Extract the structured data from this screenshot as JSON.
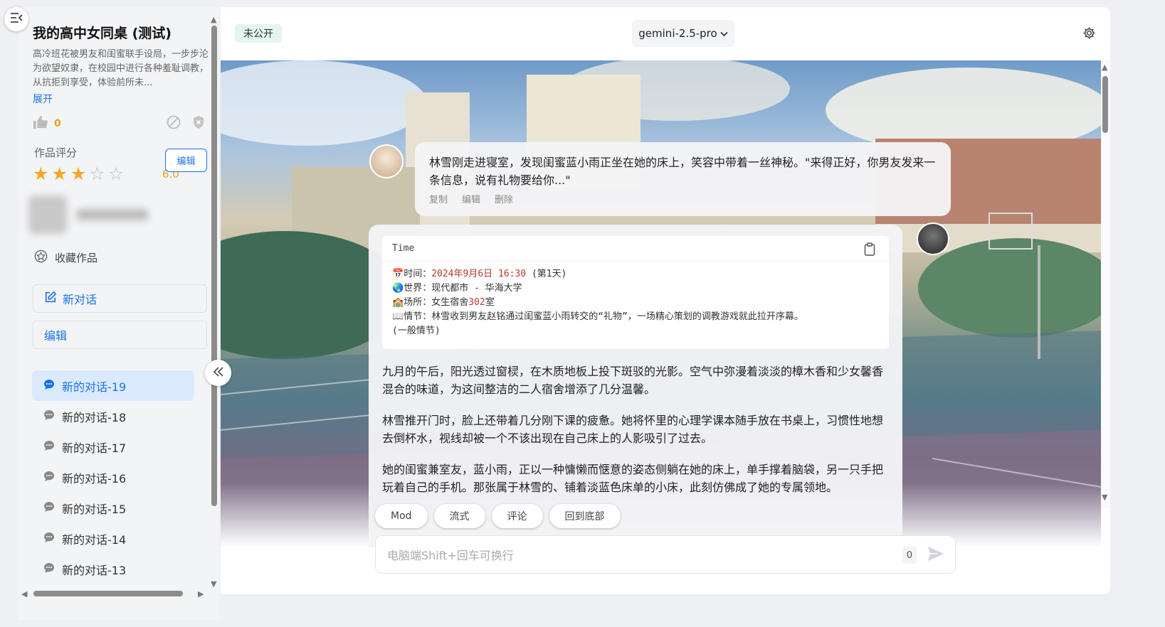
{
  "sidebar": {
    "title": "我的高中女同桌 (测试)",
    "description": "高冷班花被男友和闺蜜联手设局，一步步沦为欲望奴隶，在校园中进行各种羞耻调教，从抗拒到享受，体验前所未...",
    "expand": "展开",
    "likes": "0",
    "rating_label": "作品评分",
    "rating": "6.0",
    "stars_filled": 3,
    "stars_total": 5,
    "edit_small": "编辑",
    "favorite": "收藏作品",
    "new_chat": "新对话",
    "edit_large": "编辑",
    "conversations": [
      "新的对话-19",
      "新的对话-18",
      "新的对话-17",
      "新的对话-16",
      "新的对话-15",
      "新的对话-14",
      "新的对话-13"
    ]
  },
  "header": {
    "status_badge": "未公开",
    "model": "gemini-2.5-pro"
  },
  "chat": {
    "first_message": "林雪刚走进寝室，发现闺蜜蓝小雨正坐在她的床上，笑容中带着一丝神秘。\"来得正好，你男友发来一条信息，说有礼物要给你...\"",
    "actions": {
      "copy": "复制",
      "edit": "编辑",
      "delete": "删除"
    },
    "time_block": {
      "title": "Time",
      "time_label": "时间：",
      "time_date": "2024年9月6日",
      "time_clock": "16:30",
      "time_day": "(第1天)",
      "world": "世界：现代都市 - 华海大学",
      "place_label": "场所：女生宿舍",
      "place_room": "302",
      "place_suffix": "室",
      "plot": "情节：林雪收到男友赵铭通过闺蜜蓝小雨转交的“礼物”，一场精心策划的调教游戏就此拉开序幕。",
      "plot_type": "(一般情节)"
    },
    "paragraphs": [
      "九月的午后，阳光透过窗棂，在木质地板上投下斑驳的光影。空气中弥漫着淡淡的樟木香和少女馨香混合的味道，为这间整洁的二人宿舍增添了几分温馨。",
      "林雪推开门时，脸上还带着几分刚下课的疲惫。她将怀里的心理学课本随手放在书桌上，习惯性地想去倒杯水，视线却被一个不该出现在自己床上的人影吸引了过去。",
      "她的闺蜜兼室友，蓝小雨，正以一种慵懒而惬意的姿态侧躺在她的床上，单手撑着脑袋，另一只手把玩着自己的手机。那张属于林雪的、铺着淡蓝色床单的小床，此刻仿佛成了她的专属领地。"
    ]
  },
  "bottom_buttons": [
    "Mod",
    "流式",
    "评论",
    "回到底部"
  ],
  "input": {
    "placeholder": "电脑端Shift+回车可换行",
    "count": "0"
  },
  "colors": {
    "accent": "#1a73e8",
    "rating": "#f5a623",
    "badge_bg": "#e3f5ec"
  }
}
